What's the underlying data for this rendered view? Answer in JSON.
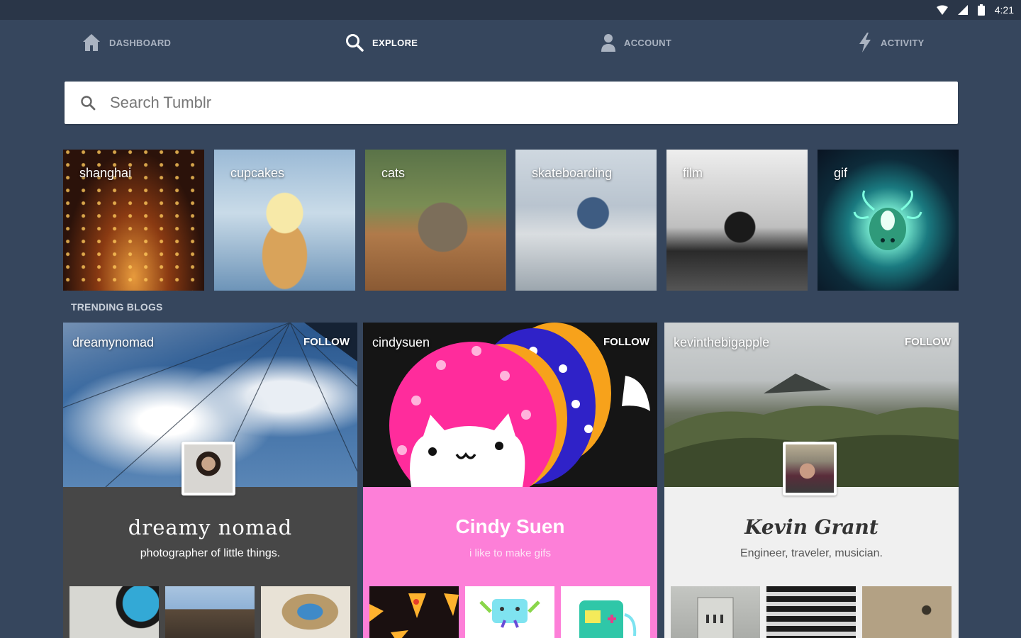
{
  "status_bar": {
    "time": "4:21"
  },
  "nav": {
    "dashboard": "DASHBOARD",
    "explore": "EXPLORE",
    "account": "ACCOUNT",
    "activity": "ACTIVITY"
  },
  "search": {
    "placeholder": "Search Tumblr"
  },
  "tags": [
    {
      "label": "shanghai"
    },
    {
      "label": "cupcakes"
    },
    {
      "label": "cats"
    },
    {
      "label": "skateboarding"
    },
    {
      "label": "film"
    },
    {
      "label": "gif"
    }
  ],
  "trending": {
    "title": "TRENDING BLOGS",
    "blogs": [
      {
        "name": "dreamynomad",
        "follow": "FOLLOW",
        "title": "dreamy nomad",
        "description": "photographer of little things."
      },
      {
        "name": "cindysuen",
        "follow": "FOLLOW",
        "title": "Cindy Suen",
        "description": "i like to make gifs"
      },
      {
        "name": "kevinthebigapple",
        "follow": "FOLLOW",
        "title": "Kevin Grant",
        "description": "Engineer, traveler, musician."
      }
    ]
  },
  "colors": {
    "background": "#36465d",
    "status_bar": "#2a3648",
    "cindy_accent": "#fd7fd8",
    "dreamy_body": "#474747"
  },
  "icons": {
    "dashboard": "house-icon",
    "explore": "search-icon",
    "account": "person-icon",
    "activity": "lightning-icon"
  }
}
